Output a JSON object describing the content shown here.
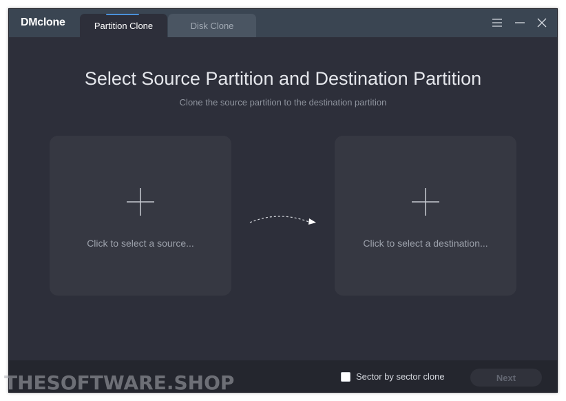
{
  "app": {
    "logo": "DMclone"
  },
  "tabs": [
    {
      "label": "Partition Clone",
      "active": true
    },
    {
      "label": "Disk Clone",
      "active": false
    }
  ],
  "window_controls": {
    "menu_icon": "hamburger-icon",
    "minimize_icon": "minimize-icon",
    "close_icon": "close-icon"
  },
  "main": {
    "title": "Select Source Partition and Destination Partition",
    "subtitle": "Clone the source partition to the destination partition",
    "source_label": "Click to select a source...",
    "destination_label": "Click to select a destination..."
  },
  "footer": {
    "sector_label": "Sector by sector clone",
    "sector_checked": false,
    "next_label": "Next"
  },
  "watermark": "THESOFTWARE.SHOP",
  "colors": {
    "window_bg": "#2d2f3a",
    "titlebar_bg": "#3a4552",
    "card_bg": "#363842",
    "footer_bg": "#24262e",
    "accent": "#4a90d9"
  }
}
